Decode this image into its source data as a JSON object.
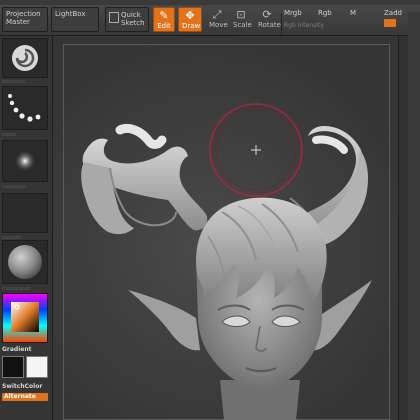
{
  "toolbar": {
    "projection_master": "Projection Master",
    "lightbox": "LightBox",
    "quick_sketch": "Quick Sketch",
    "edit": "Edit",
    "draw": "Draw",
    "move": "Move",
    "scale": "Scale",
    "rotate": "Rotate",
    "mrgb": "Mrgb",
    "rgb": "Rgb",
    "m": "M",
    "zadd": "Zadd",
    "rgb_intensity": "Rgb Intensity"
  },
  "left_shelf": {
    "gradient_label": "Gradient",
    "switchcolor_label": "SwitchColor",
    "alternate_label": "Alternate"
  },
  "colors": {
    "accent": "#e0731b",
    "canvas": "#3b3b3b",
    "draw_circle": "#c0203a"
  },
  "icons": [
    "alpha-swirl-icon",
    "stroke-dots-icon",
    "dot-stroke-icon",
    "sphere-material-icon",
    "color-picker-icon",
    "edit-icon",
    "draw-icon",
    "move-icon",
    "scale-icon",
    "rotate-icon",
    "crosshair-icon"
  ]
}
